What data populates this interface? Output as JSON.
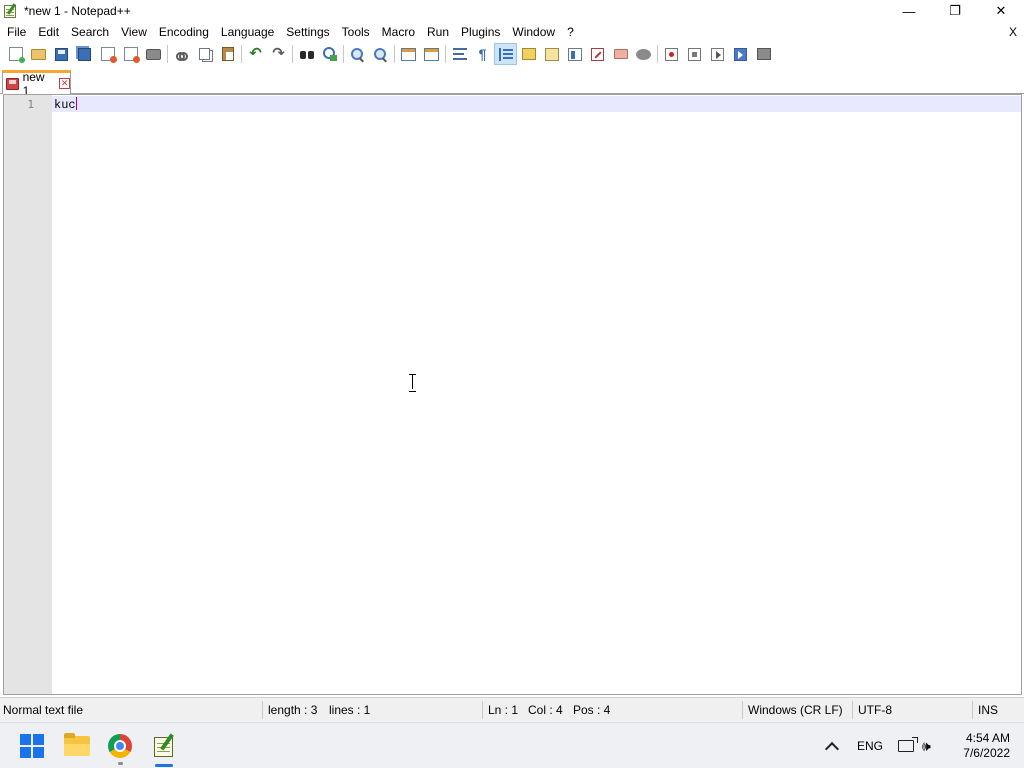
{
  "window": {
    "title": "*new 1 - Notepad++",
    "minimize_glyph": "—",
    "maximize_glyph": "❐",
    "close_glyph": "✕"
  },
  "menu": {
    "items": [
      "File",
      "Edit",
      "Search",
      "View",
      "Encoding",
      "Language",
      "Settings",
      "Tools",
      "Macro",
      "Run",
      "Plugins",
      "Window",
      "?"
    ],
    "close_doc": "X"
  },
  "toolbar": {
    "buttons": [
      "new-file-icon",
      "open-file-icon",
      "save-icon",
      "save-all-icon",
      "close-icon",
      "close-all-icon",
      "print-icon",
      "cut-icon",
      "copy-icon",
      "paste-icon",
      "undo-icon",
      "redo-icon",
      "find-icon",
      "replace-icon",
      "zoom-in-icon",
      "zoom-out-icon",
      "sync-vertical-icon",
      "sync-horizontal-icon",
      "word-wrap-icon",
      "show-all-characters-icon",
      "indent-guide-icon",
      "user-defined-language-icon",
      "document-map-icon",
      "document-list-icon",
      "function-list-icon",
      "folder-as-workspace-icon",
      "monitoring-icon",
      "start-recording-icon",
      "stop-recording-icon",
      "playback-icon",
      "run-macro-multiple-icon",
      "save-macro-icon"
    ],
    "active_button": "indent-guide-icon"
  },
  "tabs": [
    {
      "label": "new 1",
      "close_glyph": "✕",
      "active": true
    }
  ],
  "editor": {
    "line_number": "1",
    "text": "kuc",
    "caret_color": "#8000ff",
    "current_line_color": "#e8e8ff"
  },
  "status": {
    "file_type": "Normal text file",
    "length": "length : 3",
    "lines": "lines : 1",
    "ln": "Ln : 1",
    "col": "Col : 4",
    "pos": "Pos : 4",
    "eol": "Windows (CR LF)",
    "encoding": "UTF-8",
    "mode": "INS"
  },
  "taskbar": {
    "apps": [
      "start-icon",
      "file-explorer-icon",
      "chrome-icon",
      "notepad-plus-plus-icon"
    ],
    "language": "ENG",
    "volume_glyph": "🕪",
    "time": "4:54 AM",
    "date": "7/6/2022"
  },
  "colors": {
    "tab_accent": "#f6a732",
    "taskbar_accent": "#1a73e8"
  }
}
